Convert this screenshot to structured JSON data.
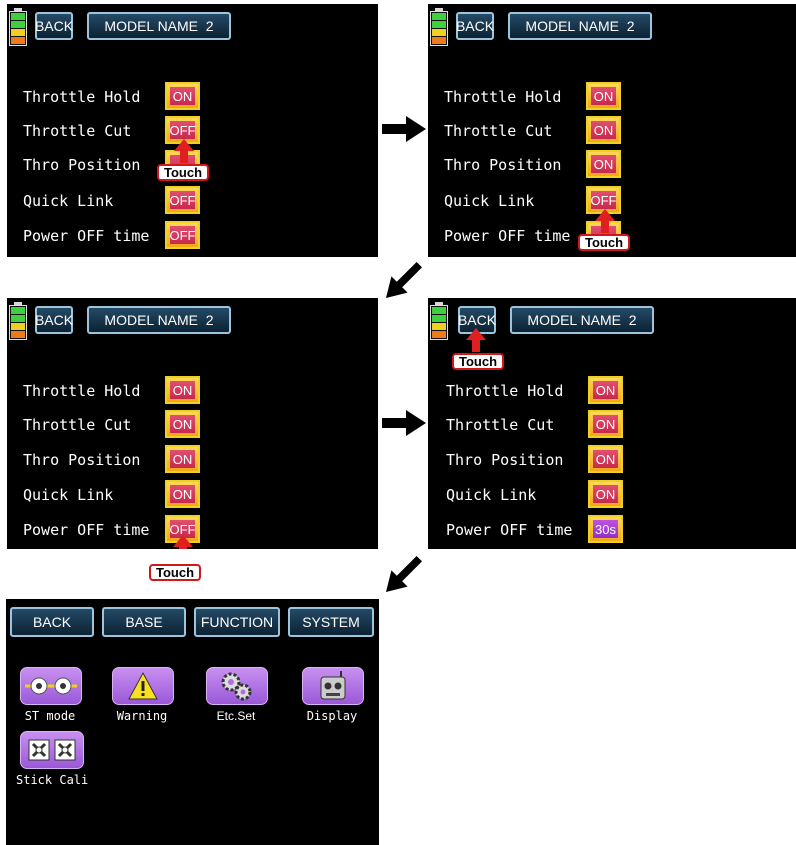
{
  "screens": {
    "s1": {
      "back": "BACK",
      "model": "MODEL NAME  2",
      "rows": [
        {
          "label": "Throttle Hold",
          "value": "ON"
        },
        {
          "label": "Throttle Cut",
          "value": "OFF"
        },
        {
          "label": "Thro Position",
          "value": ""
        },
        {
          "label": "Quick Link",
          "value": "OFF"
        },
        {
          "label": "Power OFF time",
          "value": "OFF"
        }
      ],
      "touch": "Touch"
    },
    "s2": {
      "back": "BACK",
      "model": "MODEL NAME  2",
      "rows": [
        {
          "label": "Throttle Hold",
          "value": "ON"
        },
        {
          "label": "Throttle Cut",
          "value": "ON"
        },
        {
          "label": "Thro Position",
          "value": "ON"
        },
        {
          "label": "Quick Link",
          "value": "OFF"
        },
        {
          "label": "Power OFF time",
          "value": ""
        }
      ],
      "touch": "Touch"
    },
    "s3": {
      "back": "BACK",
      "model": "MODEL NAME  2",
      "rows": [
        {
          "label": "Throttle Hold",
          "value": "ON"
        },
        {
          "label": "Throttle Cut",
          "value": "ON"
        },
        {
          "label": "Thro Position",
          "value": "ON"
        },
        {
          "label": "Quick Link",
          "value": "ON"
        },
        {
          "label": "Power OFF time",
          "value": "OFF"
        }
      ],
      "touch": "Touch"
    },
    "s4": {
      "back": "BACK",
      "model": "MODEL NAME  2",
      "rows": [
        {
          "label": "Throttle Hold",
          "value": "ON"
        },
        {
          "label": "Throttle Cut",
          "value": "ON"
        },
        {
          "label": "Thro Position",
          "value": "ON"
        },
        {
          "label": "Quick Link",
          "value": "ON"
        },
        {
          "label": "Power OFF time",
          "value": "30s"
        }
      ],
      "touch": "Touch"
    },
    "s5": {
      "menu": [
        "BACK",
        "BASE",
        "FUNCTION",
        "SYSTEM"
      ],
      "tiles": [
        {
          "label": "ST mode",
          "icon": "sticks-icon"
        },
        {
          "label": "Warning",
          "icon": "warning-icon"
        },
        {
          "label": "Etc.Set",
          "icon": "gears-icon"
        },
        {
          "label": "Display",
          "icon": "robot-icon"
        },
        {
          "label": "Stick Cali",
          "icon": "stick-cali-icon"
        }
      ]
    }
  },
  "colors": {
    "toggle_on": "#d8365a",
    "toggle_frame": "#f2c018",
    "button_border": "#9cc4dc",
    "touch_border": "#d01818",
    "tile": "#b070e0"
  }
}
